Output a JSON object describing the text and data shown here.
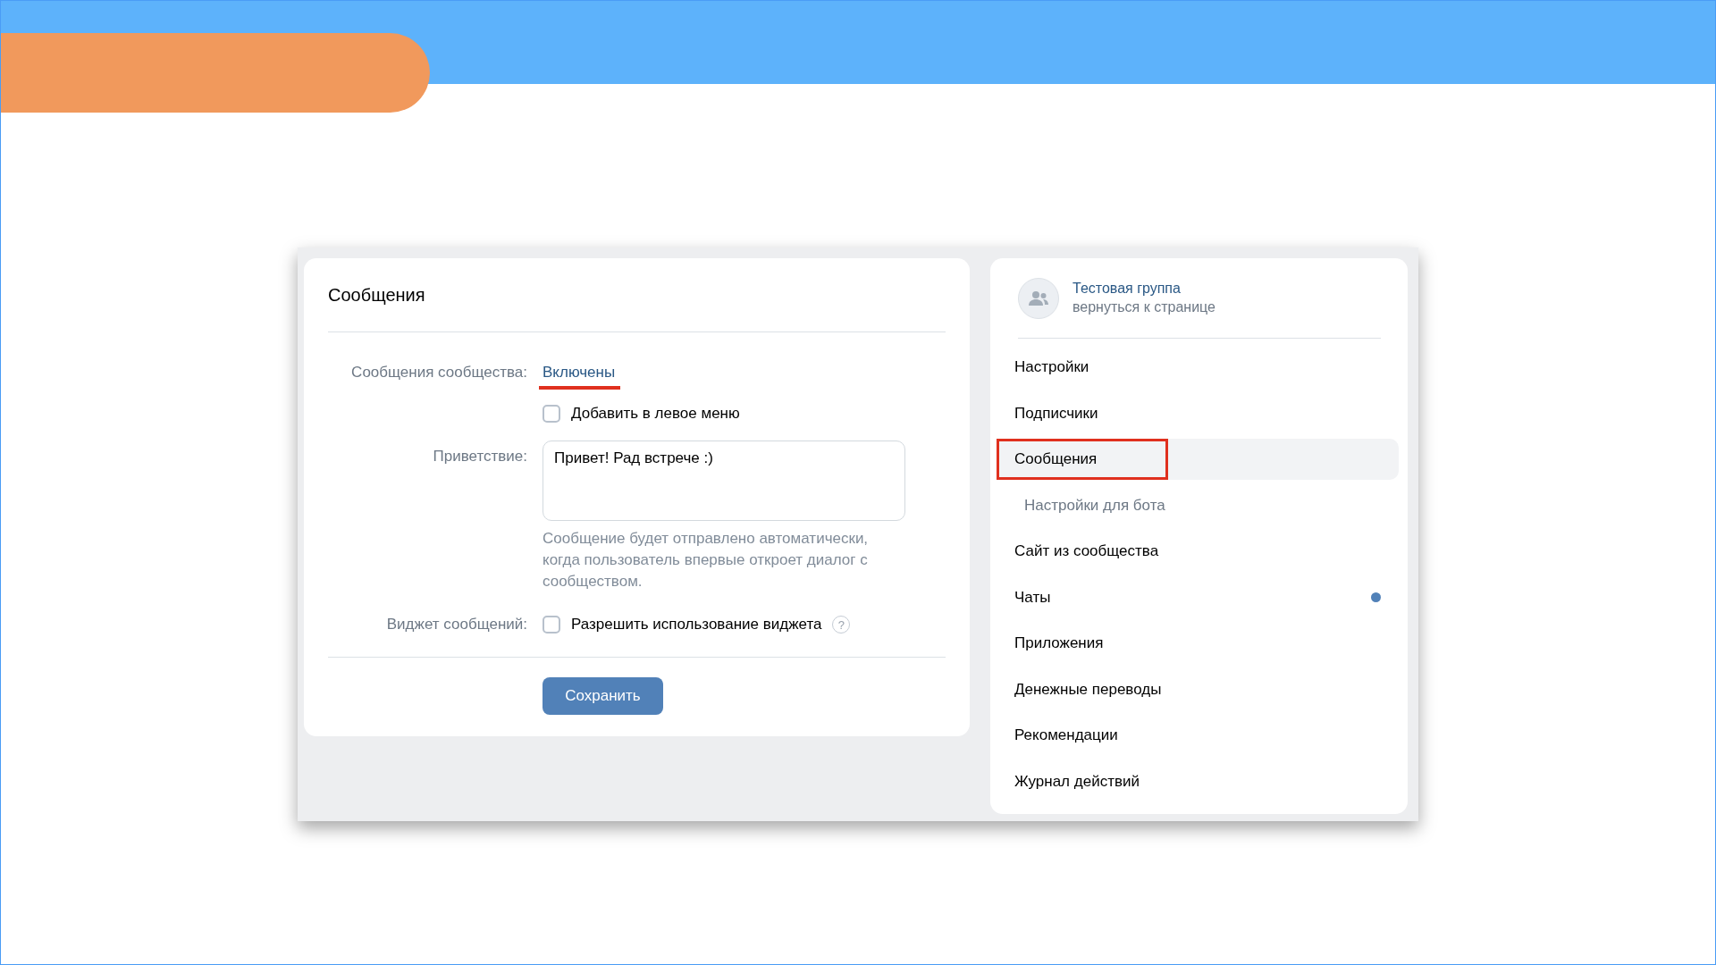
{
  "settings_panel": {
    "title": "Сообщения",
    "community_messages": {
      "label": "Сообщения сообщества:",
      "value": "Включены"
    },
    "left_menu_option": {
      "label": "Добавить в левое меню",
      "checked": false
    },
    "greeting": {
      "label": "Приветствие:",
      "value": "Привет! Рад встрече :)",
      "hint": "Сообщение будет отправлено автоматически, когда пользователь впервые откроет диалог с сообществом."
    },
    "widget": {
      "label": "Виджет сообщений:",
      "option": "Разрешить использование виджета",
      "checked": false,
      "help": "?"
    },
    "save_button": "Сохранить"
  },
  "sidebar": {
    "group": {
      "name": "Тестовая группа",
      "link": "вернуться к странице"
    },
    "items": [
      {
        "label": "Настройки",
        "kind": "item",
        "selected": false,
        "unread": false
      },
      {
        "label": "Подписчики",
        "kind": "item",
        "selected": false,
        "unread": false
      },
      {
        "label": "Сообщения",
        "kind": "item",
        "selected": true,
        "unread": false
      },
      {
        "label": "Настройки для бота",
        "kind": "subitem",
        "selected": false,
        "unread": false
      },
      {
        "label": "Сайт из сообщества",
        "kind": "item",
        "selected": false,
        "unread": false
      },
      {
        "label": "Чаты",
        "kind": "item",
        "selected": false,
        "unread": true
      },
      {
        "label": "Приложения",
        "kind": "item",
        "selected": false,
        "unread": false
      },
      {
        "label": "Денежные переводы",
        "kind": "item",
        "selected": false,
        "unread": false
      },
      {
        "label": "Рекомендации",
        "kind": "item",
        "selected": false,
        "unread": false
      },
      {
        "label": "Журнал действий",
        "kind": "item",
        "selected": false,
        "unread": false
      }
    ]
  }
}
